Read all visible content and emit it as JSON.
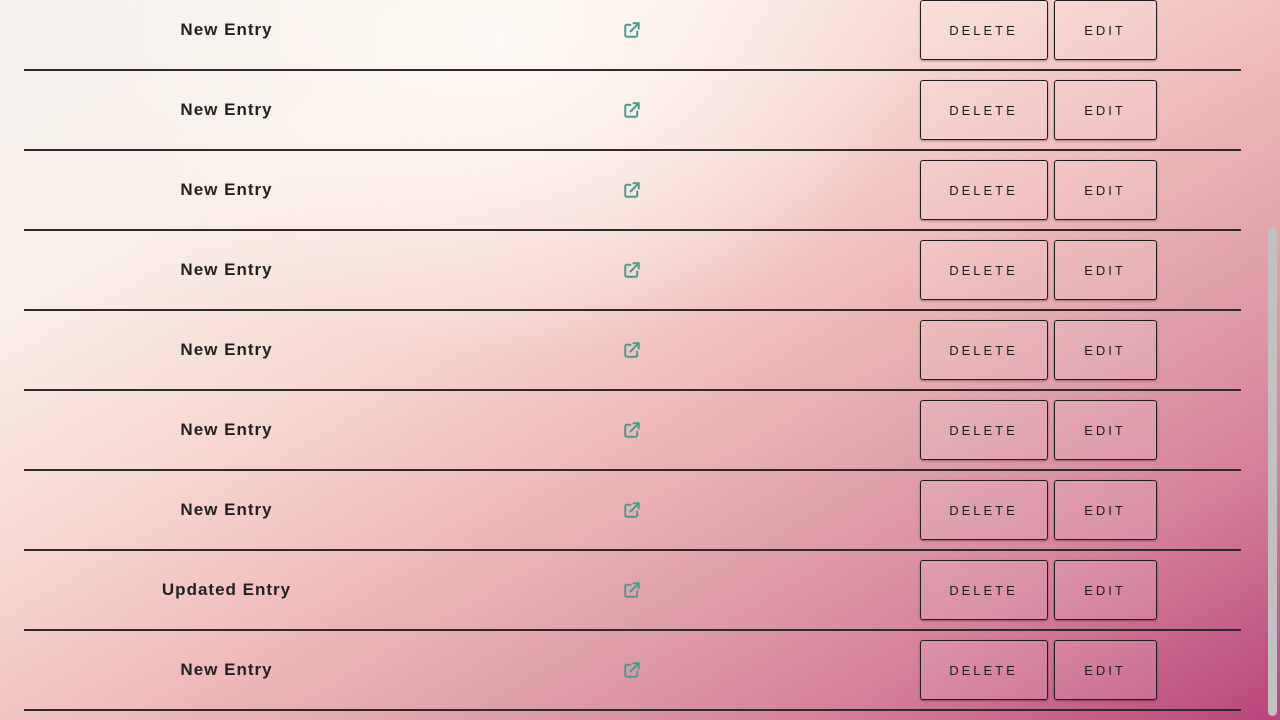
{
  "rows": [
    {
      "name": "New Entry",
      "delete_label": "DELETE",
      "edit_label": "EDIT"
    },
    {
      "name": "New Entry",
      "delete_label": "DELETE",
      "edit_label": "EDIT"
    },
    {
      "name": "New Entry",
      "delete_label": "DELETE",
      "edit_label": "EDIT"
    },
    {
      "name": "New Entry",
      "delete_label": "DELETE",
      "edit_label": "EDIT"
    },
    {
      "name": "New Entry",
      "delete_label": "DELETE",
      "edit_label": "EDIT"
    },
    {
      "name": "New Entry",
      "delete_label": "DELETE",
      "edit_label": "EDIT"
    },
    {
      "name": "New Entry",
      "delete_label": "DELETE",
      "edit_label": "EDIT"
    },
    {
      "name": "Updated Entry",
      "delete_label": "DELETE",
      "edit_label": "EDIT"
    },
    {
      "name": "New Entry",
      "delete_label": "DELETE",
      "edit_label": "EDIT"
    }
  ],
  "icons": {
    "link": "external-link-icon"
  },
  "colors": {
    "link_icon": "#4a9a8c",
    "row_border": "#2b2b2b",
    "button_border": "#1e1e1e"
  }
}
